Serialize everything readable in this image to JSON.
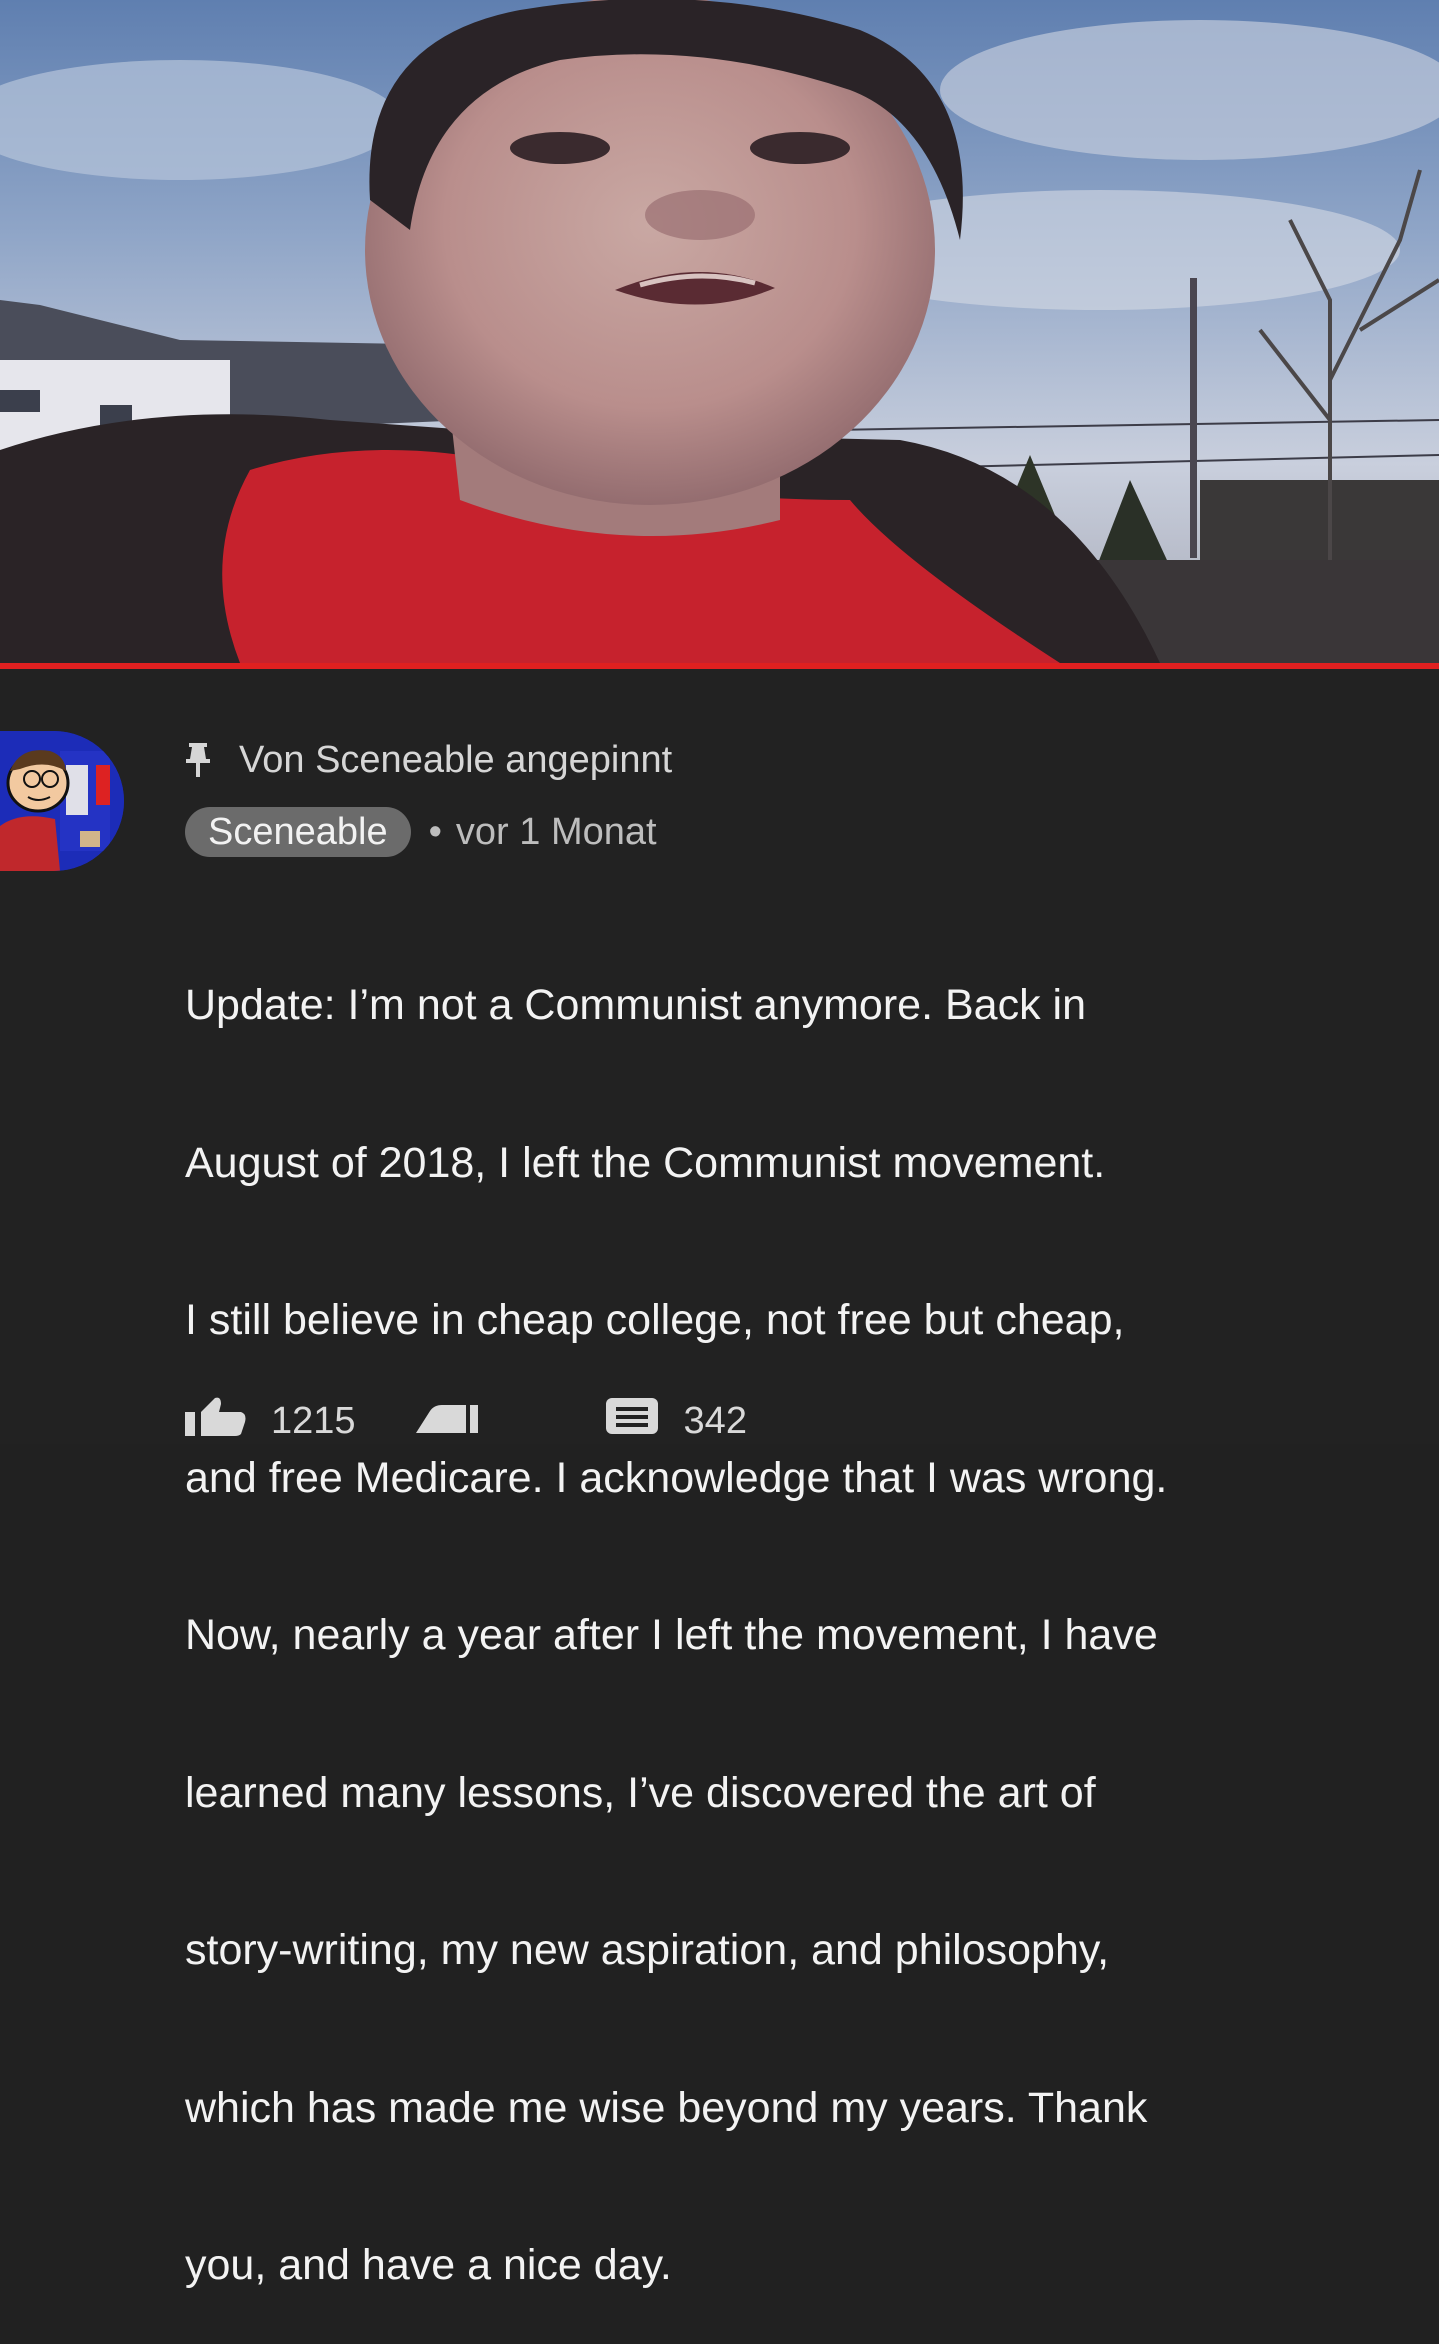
{
  "video": {
    "thumbnail": "boy-selfie-outdoors",
    "progress_fraction": 1.0,
    "progress_color": "#e02020"
  },
  "comment": {
    "avatar": "cartoon-avatar",
    "pinned_icon": "pin-icon",
    "pinned_label": "Von Sceneable angepinnt",
    "author": "Sceneable",
    "separator": "•",
    "timestamp": "vor 1 Monat",
    "lines": [
      "Update: I’m not a Communist anymore. Back in",
      "August of 2018, I left the Communist movement.",
      "I still believe in cheap college, not free but cheap,",
      "and free Medicare. I acknowledge that I was wrong.",
      "Now, nearly a year after I left the movement, I have",
      "learned many lessons, I’ve discovered the art of",
      "story-writing, my new aspiration, and philosophy,",
      "which has made me wise beyond my years. Thank",
      "you, and have a nice day."
    ],
    "like_count": "1215",
    "reply_count": "342",
    "icons": {
      "like": "thumbs-up-icon",
      "dislike": "thumbs-down-icon",
      "reply": "comment-icon"
    },
    "colors": {
      "background": "#222222",
      "author_chip": "#6b6b6b"
    }
  }
}
